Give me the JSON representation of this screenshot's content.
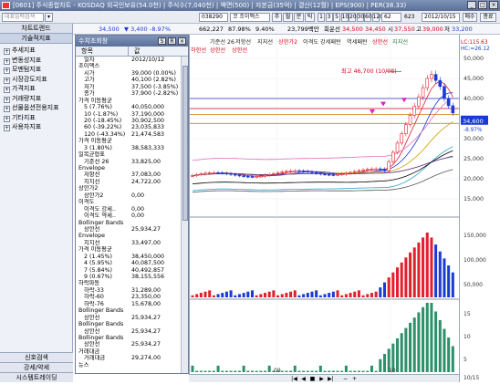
{
  "window": {
    "title": "[0601] 주식종합차트 - KOSDAQ 외국인보유(54.0천) | 주식수(7,040천) | 액면(500) | 자본금(35억) | 결산(12월) | EPS(900) | PER(38.33)"
  },
  "toolbar": {
    "search_placeholder": "대표입력검색",
    "code": "038290",
    "name": "코 조이맥스",
    "btn_week": "주",
    "btn_month": "월",
    "btn_minute": "분",
    "btn_tick": "틱",
    "intervals": [
      "1",
      "3",
      "5",
      "10",
      "20",
      "30",
      "60",
      "120"
    ],
    "count_value": "62",
    "count_total": "623",
    "date_value": "2012/10/15",
    "order_btn": "매수",
    "close_btn": "종료"
  },
  "quote": {
    "price": "34,500",
    "change": "▼ 3,400",
    "rate": "-8.97%",
    "volume": "662,227",
    "ratio": "87.98%",
    "ratio2": "9.40%",
    "cum": "23,799백만",
    "label_hoe": "회운선",
    "open": "34,500",
    "high": "34,450",
    "low_label": "시",
    "low": "37,550",
    "prev_label": "고",
    "prev": "39,000",
    "close_label": "저",
    "last": "33,200"
  },
  "legend": {
    "line1a": "기준선 26",
    "line1b": "저항선",
    "line1c": "지지선",
    "line1d": "상한가2",
    "line1e": "이격도 강세패턴",
    "line1f": "역세패턴",
    "line1g": "상한선",
    "line1h": "지지선",
    "line2a": "하한선",
    "line2b": "상한선",
    "line2c": "상한선"
  },
  "left_nav": {
    "header": "차트트렌드",
    "subheader": "기술적지표",
    "items": [
      "추세지표",
      "변동성지표",
      "모멘텀지표",
      "시장강도지표",
      "가격지표",
      "거래량지표",
      "선물옵션전용지표",
      "기타지표",
      "사용자지표"
    ],
    "bottom": [
      "신호검색",
      "강세/약세",
      "시스템트레이딩"
    ]
  },
  "panel": {
    "title": "수치조회창",
    "btn_s": "S",
    "btn_r": "R",
    "col_item": "항목",
    "col_value": "값",
    "rows": [
      {
        "k": "일자",
        "v": "2012/10/12",
        "g": false
      },
      {
        "k": "조이맥스",
        "v": "",
        "g": true
      },
      {
        "k": "시가",
        "v": "39,000 (0.00%)",
        "g": false
      },
      {
        "k": "고가",
        "v": "40,100 (2.82%)",
        "g": false
      },
      {
        "k": "저가",
        "v": "37,500 (-3.85%)",
        "g": false
      },
      {
        "k": "종가",
        "v": "37,900 (-2.82%)",
        "g": false
      },
      {
        "k": "가격 이동평균",
        "v": "",
        "g": true
      },
      {
        "k": "5 (7.76%)",
        "v": "40,050,000",
        "g": false
      },
      {
        "k": "10 (-1.87%)",
        "v": "37,190,000",
        "g": false
      },
      {
        "k": "20 (-18.45%)",
        "v": "30,902,500",
        "g": false
      },
      {
        "k": "60 (-39.22%)",
        "v": "23,035,833",
        "g": false
      },
      {
        "k": "120 (-43.34%)",
        "v": "21,474,583",
        "g": false
      },
      {
        "k": "가격 이동평균",
        "v": "",
        "g": true
      },
      {
        "k": "3 (1.80%)",
        "v": "38,583,333",
        "g": false
      },
      {
        "k": "일목균형표",
        "v": "",
        "g": true
      },
      {
        "k": "기준선 26",
        "v": "33,825,00",
        "g": false
      },
      {
        "k": "Envelope",
        "v": "",
        "g": true
      },
      {
        "k": "저항선",
        "v": "37,083,00",
        "g": false
      },
      {
        "k": "지지선",
        "v": "24,722,00",
        "g": false
      },
      {
        "k": "상한가2",
        "v": "",
        "g": true
      },
      {
        "k": "상한가2",
        "v": "0,00",
        "g": false
      },
      {
        "k": "이격도",
        "v": "",
        "g": true
      },
      {
        "k": "이격도 강세..",
        "v": "0,00",
        "g": false
      },
      {
        "k": "이격도 약세..",
        "v": "0,00",
        "g": false
      },
      {
        "k": "Bollinger Bands",
        "v": "",
        "g": true
      },
      {
        "k": "상한선",
        "v": "25,934,27",
        "g": false
      },
      {
        "k": "Envelope",
        "v": "",
        "g": true
      },
      {
        "k": "지지선",
        "v": "33,497,00",
        "g": false
      },
      {
        "k": "가격 이동평균",
        "v": "",
        "g": true
      },
      {
        "k": "2 (1.45%)",
        "v": "38,450,000",
        "g": false
      },
      {
        "k": "4 (5.95%)",
        "v": "40,087,500",
        "g": false
      },
      {
        "k": "7 (5.84%)",
        "v": "40,492,857",
        "g": false
      },
      {
        "k": "9 (0.67%)",
        "v": "38,155,556",
        "g": false
      },
      {
        "k": "하락파동",
        "v": "",
        "g": true
      },
      {
        "k": "하락-33",
        "v": "31,289,00",
        "g": false
      },
      {
        "k": "하락-60",
        "v": "23,350,00",
        "g": false
      },
      {
        "k": "하락-76",
        "v": "15,678,00",
        "g": false
      },
      {
        "k": "Bollinger Bands",
        "v": "",
        "g": true
      },
      {
        "k": "상한선",
        "v": "25,934,27",
        "g": false
      },
      {
        "k": "Bollinger Bands",
        "v": "",
        "g": true
      },
      {
        "k": "상한선",
        "v": "25,934,27",
        "g": false
      },
      {
        "k": "Bollinger Bands",
        "v": "",
        "g": true
      },
      {
        "k": "상한선",
        "v": "25,934,27",
        "g": false
      },
      {
        "k": "거래대금",
        "v": "",
        "g": true
      },
      {
        "k": "거래대금",
        "v": "29,274,00",
        "g": false
      },
      {
        "k": "뉴스",
        "v": "",
        "g": true
      }
    ]
  },
  "chart": {
    "annotation_high": "최고 46,700 (10/08)",
    "price_axis": [
      "50,000",
      "45,000",
      "40,000",
      "35,000",
      "30,000",
      "25,000",
      "20,000",
      "15,000"
    ],
    "current_price_label": "34,600",
    "lc_label": "LC:115.63",
    "hc_label": "HC:=26.12",
    "rate_label": "-8.97%",
    "vol_axis": [
      "150,000",
      "100,000",
      "50,000"
    ],
    "amt_axis": [
      "15",
      "10",
      "5"
    ],
    "month_labels": [
      "09",
      "10"
    ],
    "date_label": "10/15",
    "colors": {
      "up": "#e0202a",
      "down": "#1a3ad6",
      "vol": "#2f8f6a"
    }
  }
}
